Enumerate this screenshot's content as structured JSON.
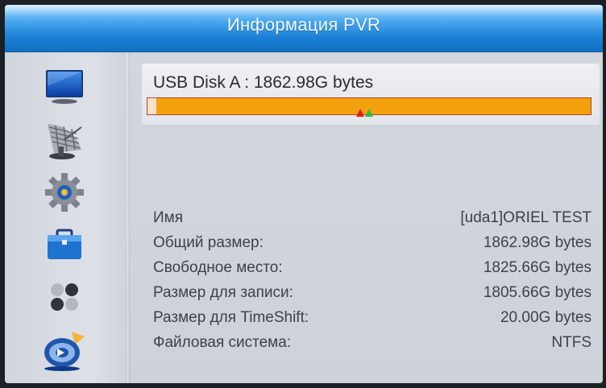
{
  "header": {
    "title": "Информация PVR"
  },
  "sidebar": {
    "items": [
      {
        "icon": "tv-screen-icon"
      },
      {
        "icon": "satellite-dish-icon"
      },
      {
        "icon": "gear-icon"
      },
      {
        "icon": "toolbox-icon"
      },
      {
        "icon": "dots-icon"
      },
      {
        "icon": "media-disc-icon",
        "selected": true
      }
    ]
  },
  "disk": {
    "label": "USB Disk A : 1862.98G bytes",
    "total_gb": 1862.98,
    "free_gb": 1825.66,
    "used_fraction": 0.02,
    "colors": {
      "bar": "#f2a10c",
      "border": "#b8412f",
      "used": "#f7e2c9",
      "marker_red": "#e0211a",
      "marker_green": "#27c23a"
    }
  },
  "info": {
    "rows": [
      {
        "label": "Имя",
        "value": "[uda1]ORIEL TEST"
      },
      {
        "label": "Общий размер:",
        "value": "1862.98G bytes"
      },
      {
        "label": "Свободное место:",
        "value": "1825.66G bytes"
      },
      {
        "label": "Размер для записи:",
        "value": "1805.66G bytes"
      },
      {
        "label": "Размер для TimeShift:",
        "value": "20.00G bytes"
      },
      {
        "label": "Файловая система:",
        "value": "NTFS"
      }
    ]
  }
}
